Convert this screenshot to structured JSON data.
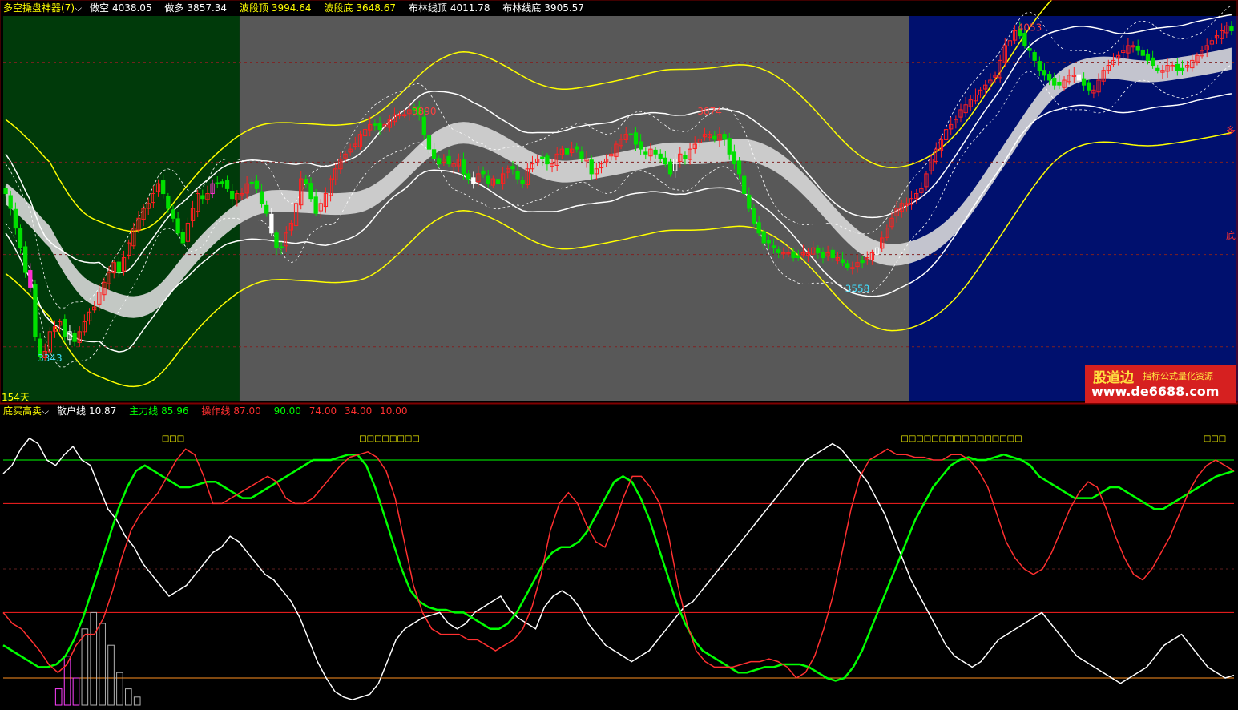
{
  "upper_panel": {
    "indicator_name": "多空操盘神器(7)",
    "items": [
      {
        "label": "做空",
        "value": "4038.05",
        "color": "#ffffff"
      },
      {
        "label": "做多",
        "value": "3857.34",
        "color": "#ffffff"
      },
      {
        "label": "波段顶",
        "value": "3994.64",
        "color": "#ffff00"
      },
      {
        "label": "波段底",
        "value": "3648.67",
        "color": "#ffff00"
      },
      {
        "label": "布林线顶",
        "value": "4011.78",
        "color": "#ffffff"
      },
      {
        "label": "布林线底",
        "value": "3905.57",
        "color": "#ffffff"
      }
    ],
    "days_label": "154天",
    "right_marker_top": "多",
    "right_marker_bottom": "底"
  },
  "lower_panel": {
    "indicator_name": "底买高卖",
    "items": [
      {
        "label": "散户线",
        "value": "10.87",
        "color": "#ffffff"
      },
      {
        "label": "主力线",
        "value": "85.96",
        "color": "#00ff00"
      },
      {
        "label": "操作线",
        "value": "87.00",
        "color": "#ff3030"
      },
      {
        "label": "",
        "value": "90.00",
        "color": "#00ff00"
      },
      {
        "label": "",
        "value": "74.00",
        "color": "#ff3030"
      },
      {
        "label": "",
        "value": "34.00",
        "color": "#ff3030"
      },
      {
        "label": "",
        "value": "10.00",
        "color": "#ff3030"
      }
    ]
  },
  "watermark": {
    "brand": "股道边",
    "slogan": "指标公式量化资源",
    "url": "www.de6688.com"
  },
  "chart_data": [
    {
      "type": "candlestick",
      "y_range": [
        3300,
        4080
      ],
      "price_labels": [
        {
          "text": "3343",
          "bar": 9,
          "pos": "low",
          "color": "#40e0ff"
        },
        {
          "text": "3890",
          "bar": 85,
          "pos": "high",
          "color": "#ff4040"
        },
        {
          "text": "3874",
          "bar": 143,
          "pos": "high",
          "color": "#ff4040"
        },
        {
          "text": "3558",
          "bar": 173,
          "pos": "low",
          "color": "#40e0ff"
        },
        {
          "text": "4053",
          "bar": 208,
          "pos": "high",
          "color": "#ff4040"
        },
        {
          "text": "4064",
          "bar": 252,
          "pos": "high",
          "color": "#ff4040"
        }
      ],
      "zones": [
        {
          "from": 0,
          "to": 48,
          "color": "#003a0a"
        },
        {
          "from": 48,
          "to": 184,
          "color": "#585858"
        },
        {
          "from": 184,
          "to": 256,
          "color": "#00106e"
        }
      ],
      "close": [
        3720,
        3690,
        3650,
        3610,
        3560,
        3530,
        3430,
        3390,
        3400,
        3440,
        3450,
        3460,
        3430,
        3440,
        3420,
        3440,
        3460,
        3480,
        3490,
        3520,
        3540,
        3560,
        3580,
        3560,
        3590,
        3620,
        3650,
        3670,
        3690,
        3700,
        3720,
        3740,
        3720,
        3690,
        3670,
        3640,
        3620,
        3660,
        3690,
        3720,
        3710,
        3720,
        3740,
        3740,
        3740,
        3730,
        3710,
        3720,
        3720,
        3740,
        3740,
        3730,
        3700,
        3680,
        3640,
        3610,
        3610,
        3640,
        3660,
        3700,
        3750,
        3740,
        3710,
        3680,
        3700,
        3720,
        3750,
        3770,
        3790,
        3800,
        3810,
        3820,
        3840,
        3850,
        3860,
        3860,
        3850,
        3860,
        3870,
        3880,
        3880,
        3880,
        3890,
        3890,
        3880,
        3840,
        3810,
        3790,
        3780,
        3790,
        3780,
        3780,
        3790,
        3760,
        3750,
        3740,
        3760,
        3760,
        3740,
        3750,
        3740,
        3760,
        3770,
        3770,
        3750,
        3740,
        3770,
        3780,
        3790,
        3790,
        3780,
        3780,
        3800,
        3810,
        3800,
        3810,
        3810,
        3790,
        3790,
        3760,
        3770,
        3780,
        3790,
        3800,
        3820,
        3830,
        3840,
        3840,
        3820,
        3810,
        3800,
        3810,
        3800,
        3790,
        3780,
        3760,
        3790,
        3800,
        3790,
        3810,
        3820,
        3830,
        3840,
        3840,
        3830,
        3840,
        3830,
        3800,
        3780,
        3760,
        3720,
        3690,
        3660,
        3640,
        3620,
        3620,
        3610,
        3600,
        3600,
        3600,
        3590,
        3590,
        3600,
        3600,
        3610,
        3600,
        3590,
        3600,
        3590,
        3590,
        3580,
        3570,
        3570,
        3580,
        3580,
        3590,
        3600,
        3610,
        3630,
        3650,
        3670,
        3690,
        3700,
        3700,
        3710,
        3720,
        3730,
        3760,
        3790,
        3810,
        3830,
        3850,
        3860,
        3870,
        3890,
        3900,
        3910,
        3920,
        3930,
        3940,
        3950,
        3960,
        3990,
        4020,
        4030,
        4050,
        4040,
        4020,
        4010,
        3990,
        3970,
        3960,
        3950,
        3940,
        3940,
        3950,
        3960,
        3960,
        3950,
        3940,
        3930,
        3930,
        3950,
        3970,
        3980,
        3990,
        4000,
        4010,
        4020,
        4020,
        4010,
        4000,
        3990,
        3980,
        3970,
        3970,
        3980,
        3980,
        3970,
        3970,
        3980,
        3990,
        4000,
        4010,
        4020,
        4030,
        4040,
        4050,
        4060,
        4050
      ]
    },
    {
      "type": "line",
      "y_range": [
        0,
        100
      ],
      "reference_lines": [
        {
          "value": 90,
          "color": "#00ff00"
        },
        {
          "value": 74,
          "color": "#ff2020"
        },
        {
          "value": 34,
          "color": "#ff2020"
        },
        {
          "value": 10,
          "color": "#ff9020"
        }
      ],
      "series": [
        {
          "name": "散户线",
          "color": "#ffffff",
          "values": [
            85,
            88,
            94,
            98,
            96,
            90,
            88,
            92,
            95,
            90,
            88,
            80,
            72,
            68,
            62,
            58,
            52,
            48,
            44,
            40,
            42,
            44,
            48,
            52,
            56,
            58,
            62,
            60,
            56,
            52,
            48,
            46,
            42,
            38,
            32,
            24,
            16,
            10,
            5,
            3,
            2,
            3,
            4,
            8,
            16,
            24,
            28,
            30,
            32,
            33,
            34,
            30,
            28,
            30,
            34,
            36,
            38,
            40,
            35,
            32,
            30,
            28,
            36,
            40,
            42,
            40,
            36,
            30,
            26,
            22,
            20,
            18,
            16,
            18,
            20,
            24,
            28,
            32,
            36,
            38,
            42,
            46,
            50,
            54,
            58,
            62,
            66,
            70,
            74,
            78,
            82,
            86,
            90,
            92,
            94,
            96,
            94,
            90,
            86,
            82,
            76,
            70,
            62,
            54,
            46,
            40,
            34,
            28,
            22,
            18,
            16,
            14,
            16,
            20,
            24,
            26,
            28,
            30,
            32,
            34,
            30,
            26,
            22,
            18,
            16,
            14,
            12,
            10,
            8,
            10,
            12,
            14,
            18,
            22,
            24,
            26,
            22,
            18,
            14,
            12,
            10,
            11
          ]
        },
        {
          "name": "主力线",
          "color": "#00ff00",
          "values": [
            22,
            20,
            18,
            16,
            14,
            14,
            15,
            18,
            24,
            32,
            42,
            52,
            62,
            72,
            80,
            86,
            88,
            86,
            84,
            82,
            80,
            80,
            81,
            82,
            82,
            80,
            78,
            76,
            76,
            78,
            80,
            82,
            84,
            86,
            88,
            90,
            90,
            90,
            91,
            92,
            92,
            88,
            80,
            70,
            60,
            50,
            42,
            38,
            36,
            35,
            35,
            34,
            34,
            32,
            30,
            28,
            28,
            30,
            34,
            40,
            46,
            52,
            56,
            58,
            58,
            60,
            64,
            70,
            76,
            82,
            84,
            82,
            76,
            68,
            58,
            48,
            38,
            30,
            24,
            20,
            18,
            16,
            14,
            12,
            12,
            13,
            14,
            14,
            15,
            15,
            15,
            14,
            12,
            10,
            9,
            10,
            14,
            20,
            28,
            36,
            44,
            52,
            60,
            68,
            74,
            80,
            84,
            88,
            90,
            91,
            90,
            90,
            91,
            92,
            91,
            90,
            88,
            84,
            82,
            80,
            78,
            76,
            76,
            76,
            78,
            80,
            80,
            78,
            76,
            74,
            72,
            72,
            74,
            76,
            78,
            80,
            82,
            84,
            85,
            86
          ]
        },
        {
          "name": "操作线",
          "color": "#ff3030",
          "values": [
            34,
            30,
            28,
            24,
            20,
            15,
            12,
            15,
            22,
            26,
            26,
            32,
            42,
            54,
            64,
            70,
            74,
            78,
            84,
            90,
            94,
            92,
            84,
            74,
            74,
            76,
            78,
            80,
            82,
            84,
            82,
            76,
            74,
            74,
            76,
            80,
            84,
            88,
            91,
            92,
            93,
            91,
            86,
            76,
            60,
            44,
            34,
            28,
            26,
            26,
            26,
            24,
            24,
            22,
            20,
            22,
            24,
            28,
            36,
            48,
            64,
            74,
            78,
            74,
            66,
            60,
            58,
            66,
            76,
            84,
            84,
            80,
            74,
            62,
            44,
            30,
            20,
            16,
            14,
            14,
            14,
            15,
            16,
            16,
            17,
            16,
            14,
            10,
            12,
            18,
            28,
            40,
            56,
            72,
            84,
            90,
            92,
            94,
            92,
            92,
            91,
            91,
            90,
            90,
            92,
            92,
            90,
            86,
            80,
            70,
            60,
            54,
            50,
            48,
            50,
            56,
            64,
            72,
            78,
            82,
            80,
            72,
            62,
            54,
            48,
            46,
            50,
            56,
            62,
            70,
            78,
            84,
            88,
            90,
            88,
            86
          ]
        }
      ],
      "volume_bars": {
        "clusters": [
          {
            "from": 6,
            "heights": [
              6,
              18,
              10,
              28,
              34,
              30,
              22,
              12,
              6,
              3
            ]
          },
          {
            "from": 147,
            "heights": [
              4,
              10,
              22,
              26,
              18,
              12,
              8,
              6,
              5,
              3
            ]
          },
          {
            "from": 199,
            "heights": [
              3,
              8,
              14,
              10,
              6,
              4,
              3,
              3,
              2,
              2
            ]
          }
        ]
      },
      "top_markers": [
        {
          "text": "□□□",
          "x": 216
        },
        {
          "text": "□□□□□□□□",
          "x": 486
        },
        {
          "text": "□□□□□□□□□□□□□□□□",
          "x": 1200
        },
        {
          "text": "□□□",
          "x": 1516
        }
      ]
    }
  ]
}
